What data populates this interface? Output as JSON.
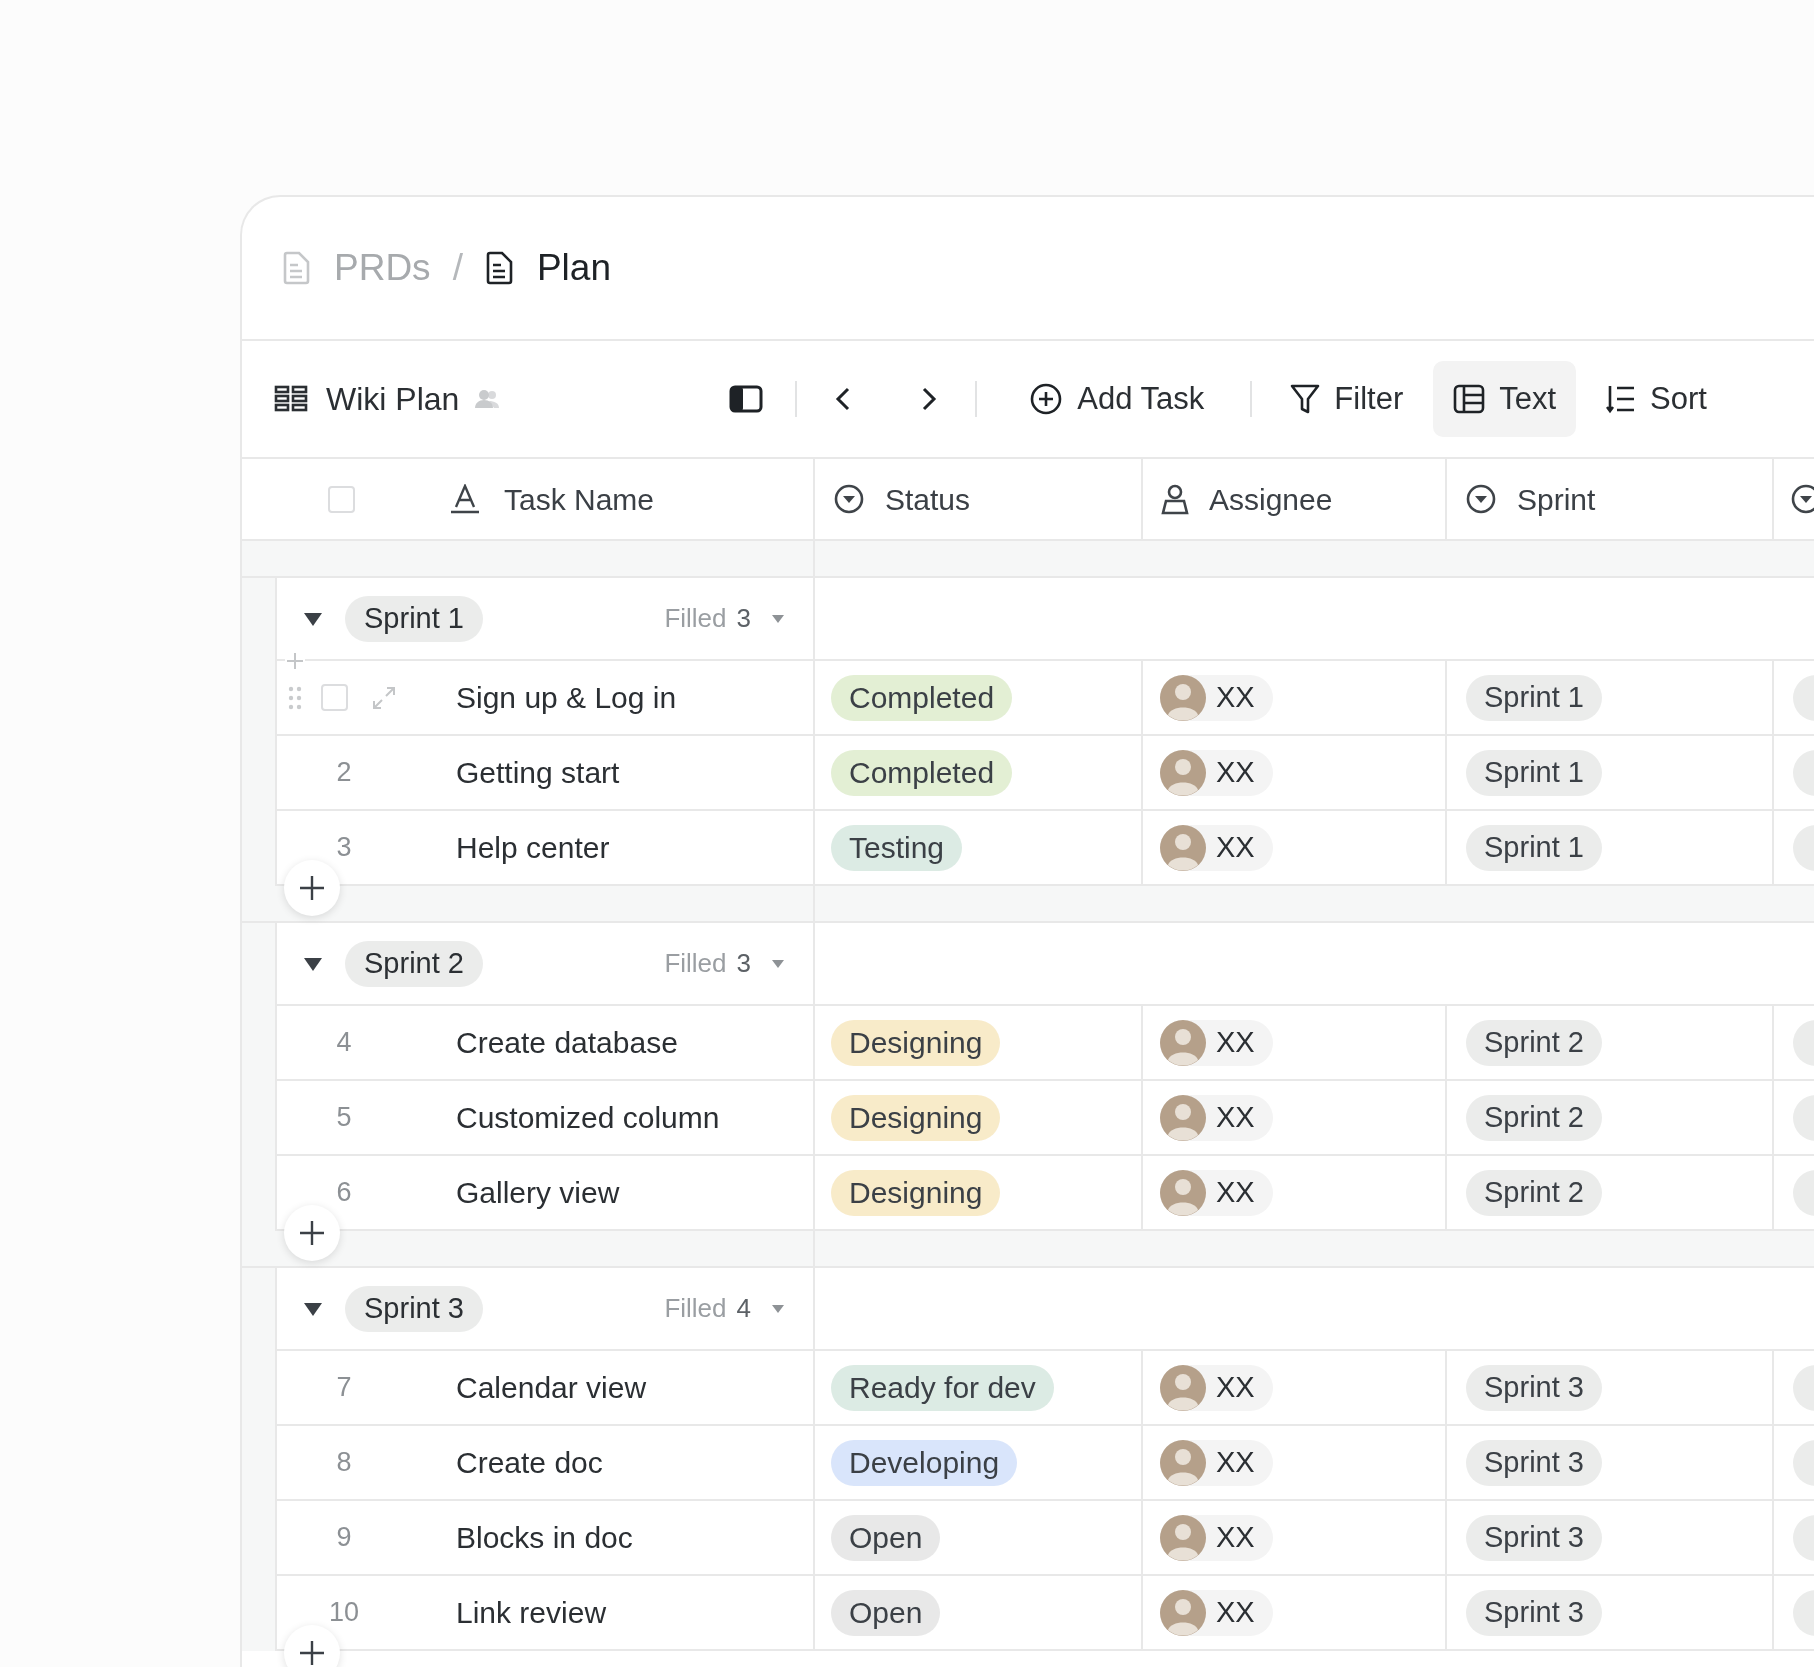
{
  "breadcrumb": [
    {
      "label": "PRDs",
      "current": false
    },
    {
      "label": "Plan",
      "current": true
    }
  ],
  "breadcrumb_separator": "/",
  "toolbar": {
    "view_name": "Wiki Plan",
    "shared": true,
    "actions": [
      {
        "label": "Add Task",
        "kind": "add",
        "selected": false
      },
      {
        "label": "Filter",
        "kind": "filter",
        "selected": false
      },
      {
        "label": "Text",
        "kind": "text",
        "selected": true
      },
      {
        "label": "Sort",
        "kind": "sort",
        "selected": false
      }
    ]
  },
  "select_all_checked": false,
  "columns": [
    {
      "label": "Task Name",
      "kind": "text"
    },
    {
      "label": "Status",
      "kind": "select"
    },
    {
      "label": "Assignee",
      "kind": "person"
    },
    {
      "label": "Sprint",
      "kind": "select"
    }
  ],
  "groups": [
    {
      "label": "Sprint 1",
      "expanded": true,
      "filled_label": "Filled",
      "filled_count": "3",
      "rows": [
        {
          "hovered": true,
          "checked": false,
          "name": "Sign up & Log in",
          "status": {
            "label": "Completed",
            "color": "#e3efd4"
          },
          "assignee": "XX",
          "sprint": "Sprint 1"
        },
        {
          "hovered": false,
          "number": "2",
          "name": "Getting start",
          "status": {
            "label": "Completed",
            "color": "#e3efd4"
          },
          "assignee": "XX",
          "sprint": "Sprint 1"
        },
        {
          "hovered": false,
          "number": "3",
          "name": "Help center",
          "status": {
            "label": "Testing",
            "color": "#dcebe4"
          },
          "assignee": "XX",
          "sprint": "Sprint 1"
        }
      ]
    },
    {
      "label": "Sprint 2",
      "expanded": true,
      "filled_label": "Filled",
      "filled_count": "3",
      "rows": [
        {
          "hovered": false,
          "number": "4",
          "name": "Create database",
          "status": {
            "label": "Designing",
            "color": "#f8ebc9"
          },
          "assignee": "XX",
          "sprint": "Sprint 2"
        },
        {
          "hovered": false,
          "number": "5",
          "name": "Customized column",
          "status": {
            "label": "Designing",
            "color": "#f8ebc9"
          },
          "assignee": "XX",
          "sprint": "Sprint 2"
        },
        {
          "hovered": false,
          "number": "6",
          "name": "Gallery view",
          "status": {
            "label": "Designing",
            "color": "#f8ebc9"
          },
          "assignee": "XX",
          "sprint": "Sprint 2"
        }
      ]
    },
    {
      "label": "Sprint 3",
      "expanded": true,
      "filled_label": "Filled",
      "filled_count": "4",
      "rows": [
        {
          "hovered": false,
          "number": "7",
          "name": "Calendar view",
          "status": {
            "label": "Ready for dev",
            "color": "#dcebe4"
          },
          "assignee": "XX",
          "sprint": "Sprint 3"
        },
        {
          "hovered": false,
          "number": "8",
          "name": "Create doc",
          "status": {
            "label": "Developing",
            "color": "#d9e5fb"
          },
          "assignee": "XX",
          "sprint": "Sprint 3"
        },
        {
          "hovered": false,
          "number": "9",
          "name": "Blocks in doc",
          "status": {
            "label": "Open",
            "color": "#e8e8e8"
          },
          "assignee": "XX",
          "sprint": "Sprint 3"
        },
        {
          "hovered": false,
          "number": "10",
          "name": "Link review",
          "status": {
            "label": "Open",
            "color": "#e8e8e8"
          },
          "assignee": "XX",
          "sprint": "Sprint 3"
        }
      ]
    }
  ]
}
